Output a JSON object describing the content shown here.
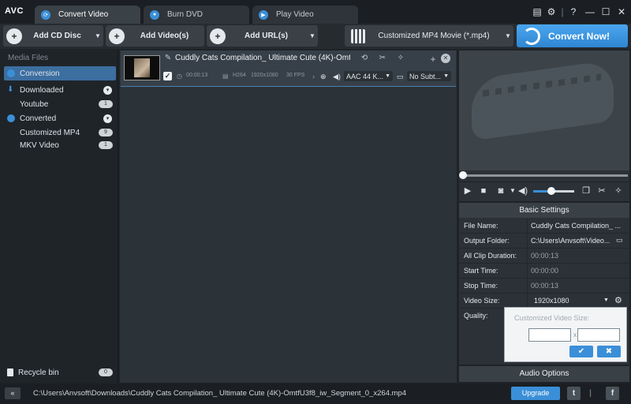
{
  "app": {
    "logo": "AVC"
  },
  "tabs": [
    {
      "label": "Convert Video"
    },
    {
      "label": "Burn DVD"
    },
    {
      "label": "Play Video"
    }
  ],
  "window_buttons": [
    "▤",
    "⚙",
    "|",
    "?",
    "—",
    "☐",
    "✕"
  ],
  "toolbar": {
    "add_cd": "Add CD Disc",
    "add_videos": "Add Video(s)",
    "add_urls": "Add URL(s)",
    "profile": "Customized MP4 Movie (*.mp4)",
    "convert": "Convert Now!"
  },
  "sidebar": {
    "heading": "Media Files",
    "items": [
      {
        "label": "Conversion",
        "badge": ""
      },
      {
        "label": "Downloaded",
        "badge": ""
      },
      {
        "label": "Youtube",
        "badge": "1"
      },
      {
        "label": "Converted",
        "badge": ""
      },
      {
        "label": "Customized MP4",
        "badge": "9"
      },
      {
        "label": "MKV Video",
        "badge": "1"
      }
    ],
    "recycle": {
      "label": "Recycle bin",
      "badge": "0"
    }
  },
  "file": {
    "name": "Cuddly Cats Compilation_ Ultimate Cute (4K)-Omtf...",
    "checked": "✓",
    "duration": "00:00:13",
    "codec": "H264",
    "resolution": "1920x1080",
    "fps": "30 FPS",
    "audio": "AAC 44 K...",
    "subtitle": "No Subt..."
  },
  "player": {
    "seek_progress": 0,
    "volume": 0.45
  },
  "settings": {
    "heading": "Basic Settings",
    "rows": [
      {
        "key": "File Name:",
        "value": "Cuddly Cats Compilation_ ..."
      },
      {
        "key": "Output Folder:",
        "value": "C:\\Users\\Anvsoft\\Video..."
      },
      {
        "key": "All Clip Duration:",
        "value": "00:00:13"
      },
      {
        "key": "Start Time:",
        "value": "00:00:00"
      },
      {
        "key": "Stop Time:",
        "value": "00:00:13"
      },
      {
        "key": "Video Size:",
        "value": "1920x1080"
      },
      {
        "key": "Quality:",
        "value": ""
      }
    ],
    "popup_title": "Customized Video Size:",
    "popup_sep": "x",
    "popup_ok": "✔",
    "popup_cancel": "✖",
    "audio_options": "Audio Options"
  },
  "status": {
    "collapse": "«",
    "path": "C:\\Users\\Anvsoft\\Downloads\\Cuddly Cats Compilation_ Ultimate Cute (4K)-OmtfU3f8_iw_Segment_0_x264.mp4",
    "upgrade": "Upgrade",
    "twitter": "t",
    "facebook": "f"
  },
  "colors": {
    "accent": "#3b8fd8",
    "selected": "#3c6ea0",
    "background": "#1e2328"
  }
}
